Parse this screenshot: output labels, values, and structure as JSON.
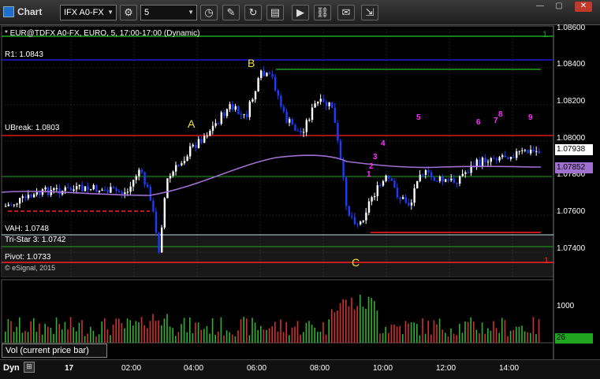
{
  "app": {
    "title": "Chart"
  },
  "toolbar": {
    "symbol_value": "IFX A0-FX",
    "interval_value": "5",
    "icons": [
      "gear-icon",
      "clock-icon",
      "pencil-icon",
      "refresh-icon",
      "news-icon",
      "play-icon",
      "link-icon",
      "note-icon"
    ]
  },
  "chart": {
    "header": "* EUR@TDFX A0-FX, EURO, 5, 17:00-17:00 (Dynamic)",
    "copyright": "© eSignal, 2015",
    "levels": {
      "r1": "R1: 1.0843",
      "ubreak": "UBreak: 1.0803",
      "vah": "VAH: 1.0748",
      "tristar": "Tri-Star 3: 1.0742",
      "pivot": "Pivot: 1.0733"
    },
    "wave_labels": {
      "a": "A",
      "b": "B",
      "c": "C"
    },
    "price_ticks": [
      "1.08600",
      "1.08400",
      "1.08200",
      "1.08000",
      "1.07800",
      "1.07600",
      "1.07400"
    ],
    "last_price": "1.07938",
    "ma_price": "1.07852",
    "edge_label_top": "1.",
    "edge_label_bottom": "1.",
    "volume_tick": "1000",
    "volume_last": "26",
    "volume_legend": "Vol (current price bar)",
    "time_ticks": [
      "17",
      "02:00",
      "04:00",
      "06:00",
      "08:00",
      "10:00",
      "12:00",
      "14:00"
    ],
    "status_mode": "Dyn",
    "counts_magenta": [
      "1",
      "2",
      "3",
      "4",
      "5",
      "6",
      "7",
      "8",
      "9"
    ],
    "colors": {
      "up_candle": "#ffffff",
      "down_candle": "#1a3cff",
      "ma_line": "#a070d0",
      "green_line": "#1fa51f",
      "red_line": "#ff2020",
      "blue_line": "#2020ff",
      "magenta_count": "#ff30ff",
      "green_count": "#30c030",
      "wave_label": "#f0e040"
    }
  }
}
